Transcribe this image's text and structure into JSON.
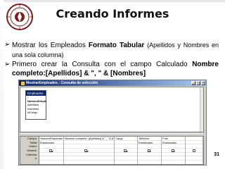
{
  "slide": {
    "title": "Creando Informes",
    "page_number": "31",
    "bullets": [
      {
        "text1": "Mostrar los Empleados ",
        "bold1": "Formato Tabular",
        "text2": " (Apellidos y Nombres en una sola columna)"
      },
      {
        "text1": "Primero crear la Consulta con el campo Calculado ",
        "bold1": "Nombre completo:[Apellidos] & \",  \" & [Nombres]"
      }
    ]
  },
  "window": {
    "title": "MostrarEmpleados : Consulta de selección",
    "controls": [
      "_",
      "□",
      "×"
    ],
    "table_box": {
      "name": "Empleados",
      "fields": [
        "*",
        "NumeroEmple",
        "Apellidos",
        "Nombres",
        "IdCargo"
      ]
    },
    "grid": {
      "row_labels": [
        "Campo:",
        "Tabla:",
        "Orden:",
        "Mostrar:",
        "Criterios:",
        "o:"
      ],
      "columns": [
        {
          "campo": "NumeroEmpleado",
          "tabla": "Empleados",
          "mostrar": true
        },
        {
          "campo": "Nombre completo: [Apellidos] & \", \" & [Nombres]",
          "tabla": "",
          "mostrar": true
        },
        {
          "campo": "Cargo",
          "tabla": "",
          "mostrar": true
        },
        {
          "campo": "Telefono",
          "tabla": "Empleados",
          "mostrar": true
        },
        {
          "campo": "Foto",
          "tabla": "Empleados",
          "mostrar": true
        },
        {
          "campo": "",
          "tabla": "",
          "mostrar": false
        }
      ]
    }
  },
  "colors": {
    "titlebar_start": "#0a246a",
    "titlebar_end": "#a6caf0",
    "window_face": "#d4d0c8",
    "logo": "#7a1e1e"
  },
  "icons": [
    "university-seal-logo",
    "arrow-bullet-icon",
    "window-app-icon"
  ]
}
